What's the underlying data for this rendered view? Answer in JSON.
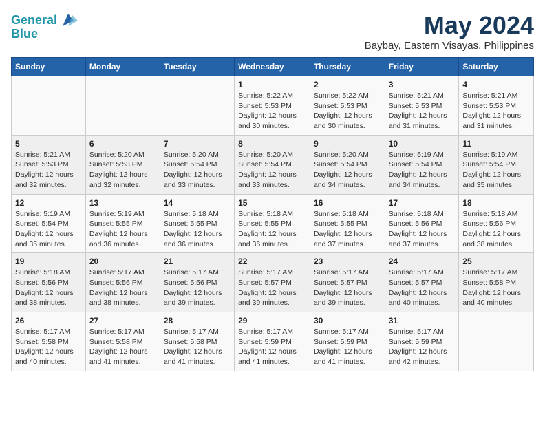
{
  "header": {
    "logo_line1": "General",
    "logo_line2": "Blue",
    "main_title": "May 2024",
    "subtitle": "Baybay, Eastern Visayas, Philippines"
  },
  "days_of_week": [
    "Sunday",
    "Monday",
    "Tuesday",
    "Wednesday",
    "Thursday",
    "Friday",
    "Saturday"
  ],
  "weeks": [
    [
      {
        "day": "",
        "info": ""
      },
      {
        "day": "",
        "info": ""
      },
      {
        "day": "",
        "info": ""
      },
      {
        "day": "1",
        "info": "Sunrise: 5:22 AM\nSunset: 5:53 PM\nDaylight: 12 hours\nand 30 minutes."
      },
      {
        "day": "2",
        "info": "Sunrise: 5:22 AM\nSunset: 5:53 PM\nDaylight: 12 hours\nand 30 minutes."
      },
      {
        "day": "3",
        "info": "Sunrise: 5:21 AM\nSunset: 5:53 PM\nDaylight: 12 hours\nand 31 minutes."
      },
      {
        "day": "4",
        "info": "Sunrise: 5:21 AM\nSunset: 5:53 PM\nDaylight: 12 hours\nand 31 minutes."
      }
    ],
    [
      {
        "day": "5",
        "info": "Sunrise: 5:21 AM\nSunset: 5:53 PM\nDaylight: 12 hours\nand 32 minutes."
      },
      {
        "day": "6",
        "info": "Sunrise: 5:20 AM\nSunset: 5:53 PM\nDaylight: 12 hours\nand 32 minutes."
      },
      {
        "day": "7",
        "info": "Sunrise: 5:20 AM\nSunset: 5:54 PM\nDaylight: 12 hours\nand 33 minutes."
      },
      {
        "day": "8",
        "info": "Sunrise: 5:20 AM\nSunset: 5:54 PM\nDaylight: 12 hours\nand 33 minutes."
      },
      {
        "day": "9",
        "info": "Sunrise: 5:20 AM\nSunset: 5:54 PM\nDaylight: 12 hours\nand 34 minutes."
      },
      {
        "day": "10",
        "info": "Sunrise: 5:19 AM\nSunset: 5:54 PM\nDaylight: 12 hours\nand 34 minutes."
      },
      {
        "day": "11",
        "info": "Sunrise: 5:19 AM\nSunset: 5:54 PM\nDaylight: 12 hours\nand 35 minutes."
      }
    ],
    [
      {
        "day": "12",
        "info": "Sunrise: 5:19 AM\nSunset: 5:54 PM\nDaylight: 12 hours\nand 35 minutes."
      },
      {
        "day": "13",
        "info": "Sunrise: 5:19 AM\nSunset: 5:55 PM\nDaylight: 12 hours\nand 36 minutes."
      },
      {
        "day": "14",
        "info": "Sunrise: 5:18 AM\nSunset: 5:55 PM\nDaylight: 12 hours\nand 36 minutes."
      },
      {
        "day": "15",
        "info": "Sunrise: 5:18 AM\nSunset: 5:55 PM\nDaylight: 12 hours\nand 36 minutes."
      },
      {
        "day": "16",
        "info": "Sunrise: 5:18 AM\nSunset: 5:55 PM\nDaylight: 12 hours\nand 37 minutes."
      },
      {
        "day": "17",
        "info": "Sunrise: 5:18 AM\nSunset: 5:56 PM\nDaylight: 12 hours\nand 37 minutes."
      },
      {
        "day": "18",
        "info": "Sunrise: 5:18 AM\nSunset: 5:56 PM\nDaylight: 12 hours\nand 38 minutes."
      }
    ],
    [
      {
        "day": "19",
        "info": "Sunrise: 5:18 AM\nSunset: 5:56 PM\nDaylight: 12 hours\nand 38 minutes."
      },
      {
        "day": "20",
        "info": "Sunrise: 5:17 AM\nSunset: 5:56 PM\nDaylight: 12 hours\nand 38 minutes."
      },
      {
        "day": "21",
        "info": "Sunrise: 5:17 AM\nSunset: 5:56 PM\nDaylight: 12 hours\nand 39 minutes."
      },
      {
        "day": "22",
        "info": "Sunrise: 5:17 AM\nSunset: 5:57 PM\nDaylight: 12 hours\nand 39 minutes."
      },
      {
        "day": "23",
        "info": "Sunrise: 5:17 AM\nSunset: 5:57 PM\nDaylight: 12 hours\nand 39 minutes."
      },
      {
        "day": "24",
        "info": "Sunrise: 5:17 AM\nSunset: 5:57 PM\nDaylight: 12 hours\nand 40 minutes."
      },
      {
        "day": "25",
        "info": "Sunrise: 5:17 AM\nSunset: 5:58 PM\nDaylight: 12 hours\nand 40 minutes."
      }
    ],
    [
      {
        "day": "26",
        "info": "Sunrise: 5:17 AM\nSunset: 5:58 PM\nDaylight: 12 hours\nand 40 minutes."
      },
      {
        "day": "27",
        "info": "Sunrise: 5:17 AM\nSunset: 5:58 PM\nDaylight: 12 hours\nand 41 minutes."
      },
      {
        "day": "28",
        "info": "Sunrise: 5:17 AM\nSunset: 5:58 PM\nDaylight: 12 hours\nand 41 minutes."
      },
      {
        "day": "29",
        "info": "Sunrise: 5:17 AM\nSunset: 5:59 PM\nDaylight: 12 hours\nand 41 minutes."
      },
      {
        "day": "30",
        "info": "Sunrise: 5:17 AM\nSunset: 5:59 PM\nDaylight: 12 hours\nand 41 minutes."
      },
      {
        "day": "31",
        "info": "Sunrise: 5:17 AM\nSunset: 5:59 PM\nDaylight: 12 hours\nand 42 minutes."
      },
      {
        "day": "",
        "info": ""
      }
    ]
  ]
}
